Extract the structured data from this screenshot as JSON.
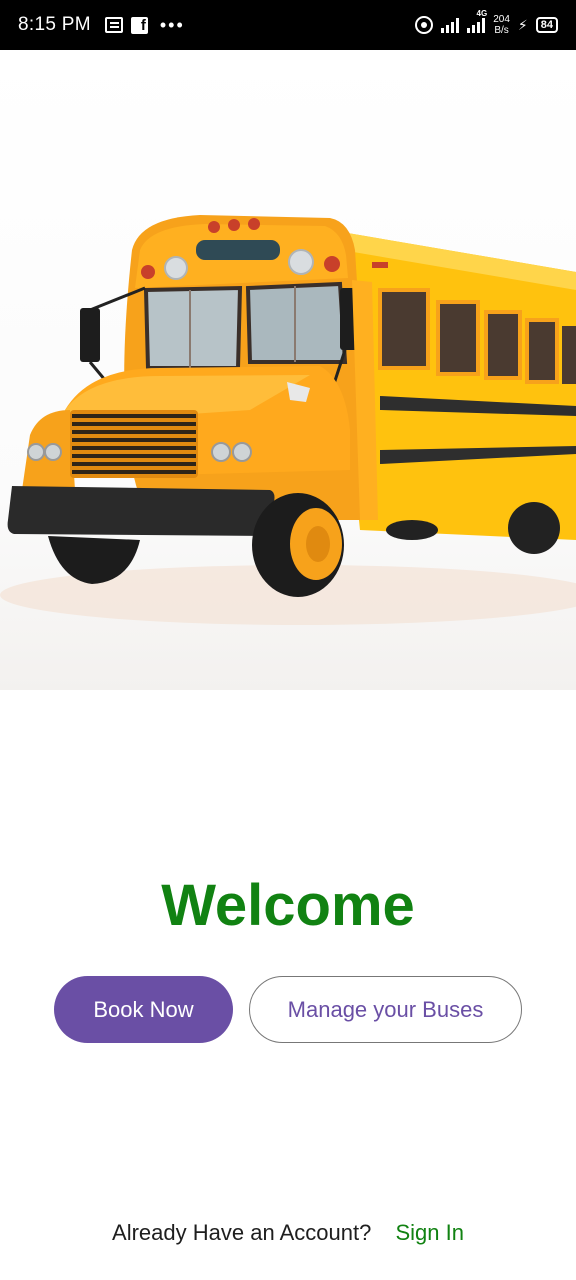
{
  "status_bar": {
    "time": "8:15 PM",
    "more": "•••",
    "network": "4G",
    "speed_value": "204",
    "speed_unit": "B/s",
    "battery": "84"
  },
  "hero": {
    "image": "school-bus-illustration"
  },
  "welcome": {
    "title": "Welcome",
    "book_label": "Book Now",
    "manage_label": "Manage your Buses"
  },
  "footer": {
    "prompt": "Already Have an Account?",
    "signin": "Sign In"
  },
  "colors": {
    "primary": "#6a4fa5",
    "accent_green": "#118212",
    "bus_yellow": "#ffc20e",
    "bus_orange": "#f7a21b"
  }
}
